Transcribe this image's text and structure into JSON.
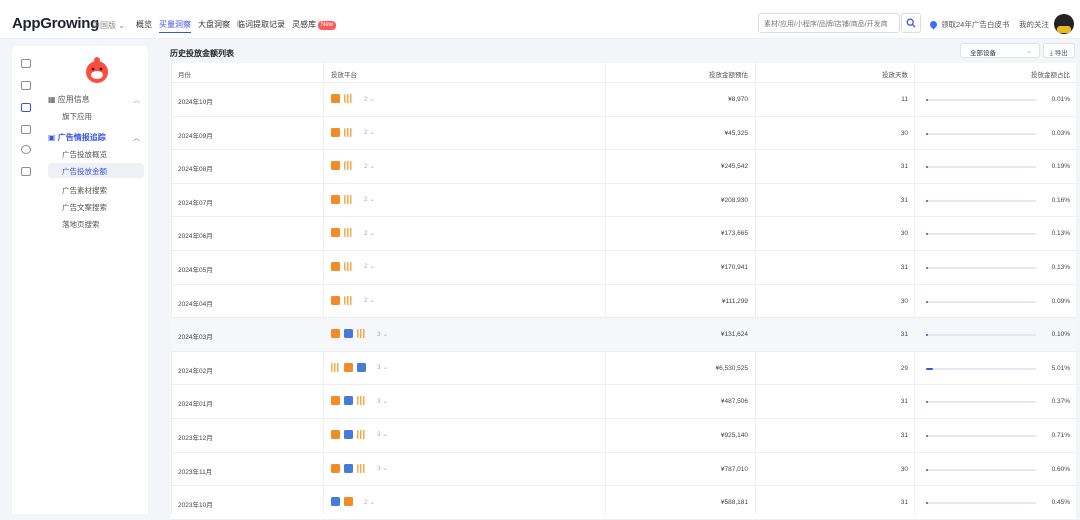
{
  "header": {
    "logo_text": "AppGrowing",
    "region": "中国版",
    "nav": [
      {
        "label": "概览",
        "active": false
      },
      {
        "label": "买量洞察",
        "active": true
      },
      {
        "label": "大盘洞察",
        "active": false
      },
      {
        "label": "临词提取记录",
        "active": false
      },
      {
        "label": "灵感库",
        "active": false,
        "badge": "New"
      }
    ],
    "search_placeholder": "素材/应用/小程序/品牌/店铺/商品/开发商",
    "whitebook_label": "领取24年广告白皮书",
    "follow_label": "我的关注"
  },
  "sidebar": {
    "sections": [
      {
        "label": "应用信息",
        "expanded": false,
        "active": false,
        "items": [
          {
            "label": "旗下应用",
            "selected": false
          }
        ]
      },
      {
        "label": "广告情报追踪",
        "expanded": true,
        "active": true,
        "items": [
          {
            "label": "广告投放概览",
            "selected": false
          },
          {
            "label": "广告投放金额",
            "selected": true
          },
          {
            "label": "广告素材搜索",
            "selected": false
          },
          {
            "label": "广告文案搜索",
            "selected": false
          },
          {
            "label": "落地页搜索",
            "selected": false
          }
        ]
      }
    ]
  },
  "main": {
    "card_title": "历史投放金额列表",
    "device_select": "全部设备",
    "export_label": "导出",
    "columns": {
      "month": "月份",
      "platform": "投放平台",
      "amount": "投放金额预估",
      "days": "投放天数",
      "share": "投放金额占比"
    },
    "rows": [
      {
        "month": "2024年10月",
        "icons": [
          "orange",
          "stripe"
        ],
        "platform_count": "2",
        "amount": "¥8,970",
        "days": "11",
        "share": "0.01%",
        "share_value": 0.01
      },
      {
        "month": "2024年09月",
        "icons": [
          "orange",
          "stripe"
        ],
        "platform_count": "2",
        "amount": "¥45,325",
        "days": "30",
        "share": "0.03%",
        "share_value": 0.03
      },
      {
        "month": "2024年08月",
        "icons": [
          "orange",
          "stripe"
        ],
        "platform_count": "2",
        "amount": "¥245,542",
        "days": "31",
        "share": "0.19%",
        "share_value": 0.19
      },
      {
        "month": "2024年07月",
        "icons": [
          "orange",
          "stripe"
        ],
        "platform_count": "2",
        "amount": "¥208,930",
        "days": "31",
        "share": "0.16%",
        "share_value": 0.16
      },
      {
        "month": "2024年06月",
        "icons": [
          "orange",
          "stripe"
        ],
        "platform_count": "2",
        "amount": "¥173,665",
        "days": "30",
        "share": "0.13%",
        "share_value": 0.13
      },
      {
        "month": "2024年05月",
        "icons": [
          "orange",
          "stripe"
        ],
        "platform_count": "2",
        "amount": "¥170,941",
        "days": "31",
        "share": "0.13%",
        "share_value": 0.13
      },
      {
        "month": "2024年04月",
        "icons": [
          "orange",
          "stripe"
        ],
        "platform_count": "2",
        "amount": "¥111,299",
        "days": "30",
        "share": "0.09%",
        "share_value": 0.09
      },
      {
        "month": "2024年03月",
        "icons": [
          "orange",
          "blue",
          "stripe"
        ],
        "platform_count": "3",
        "amount": "¥131,624",
        "days": "31",
        "share": "0.10%",
        "share_value": 0.1,
        "highlight": true
      },
      {
        "month": "2024年02月",
        "icons": [
          "stripe",
          "orange",
          "blue"
        ],
        "platform_count": "3",
        "amount": "¥6,530,525",
        "days": "29",
        "share": "5.01%",
        "share_value": 5.01
      },
      {
        "month": "2024年01月",
        "icons": [
          "orange",
          "blue",
          "stripe"
        ],
        "platform_count": "3",
        "amount": "¥487,506",
        "days": "31",
        "share": "0.37%",
        "share_value": 0.37
      },
      {
        "month": "2023年12月",
        "icons": [
          "orange",
          "blue",
          "stripe"
        ],
        "platform_count": "3",
        "amount": "¥925,140",
        "days": "31",
        "share": "0.71%",
        "share_value": 0.71
      },
      {
        "month": "2023年11月",
        "icons": [
          "orange",
          "blue",
          "stripe"
        ],
        "platform_count": "3",
        "amount": "¥787,010",
        "days": "30",
        "share": "0.60%",
        "share_value": 0.6
      },
      {
        "month": "2023年10月",
        "icons": [
          "blue",
          "orange"
        ],
        "platform_count": "2",
        "amount": "¥588,181",
        "days": "31",
        "share": "0.45%",
        "share_value": 0.45
      }
    ]
  },
  "colors": {
    "accent": "#3a55e6",
    "badge": "#ff5a5a",
    "platform_orange": "#f28c28",
    "platform_blue": "#4a7ad8"
  }
}
